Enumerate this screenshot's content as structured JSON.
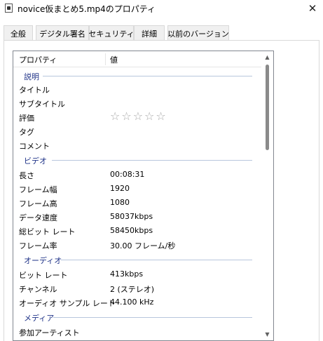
{
  "window": {
    "title": "novice仮まとめ5.mp4のプロパティ",
    "close_glyph": "✕"
  },
  "tabs": [
    {
      "label": "全般",
      "active": false
    },
    {
      "label": "デジタル署名",
      "active": false
    },
    {
      "label": "セキュリティ",
      "active": false
    },
    {
      "label": "詳細",
      "active": true
    },
    {
      "label": "以前のバージョン",
      "active": false
    }
  ],
  "list": {
    "header": {
      "property": "プロパティ",
      "value": "値"
    },
    "groups": {
      "description": "説明",
      "video": "ビデオ",
      "audio": "オーディオ",
      "media": "メディア"
    },
    "rows": {
      "title": {
        "label": "タイトル",
        "value": ""
      },
      "subtitle": {
        "label": "サブタイトル",
        "value": ""
      },
      "rating": {
        "label": "評価",
        "value": "☆☆☆☆☆"
      },
      "tags": {
        "label": "タグ",
        "value": ""
      },
      "comment": {
        "label": "コメント",
        "value": ""
      },
      "length": {
        "label": "長さ",
        "value": "00:08:31"
      },
      "frame_width": {
        "label": "フレーム幅",
        "value": "1920"
      },
      "frame_height": {
        "label": "フレーム高",
        "value": "1080"
      },
      "data_rate": {
        "label": "データ速度",
        "value": "58037kbps"
      },
      "total_bitrate": {
        "label": "総ビット レート",
        "value": "58450kbps"
      },
      "frame_rate": {
        "label": "フレーム率",
        "value": "30.00 フレーム/秒"
      },
      "bitrate": {
        "label": "ビット レート",
        "value": "413kbps"
      },
      "channels": {
        "label": "チャンネル",
        "value": "2 (ステレオ)"
      },
      "sample_rate": {
        "label": "オーディオ サンプル レート",
        "value": "44.100 kHz"
      },
      "contributing_artists": {
        "label": "参加アーティスト",
        "value": ""
      }
    }
  },
  "scrollbar": {
    "up_glyph": "▲",
    "down_glyph": "▼"
  }
}
